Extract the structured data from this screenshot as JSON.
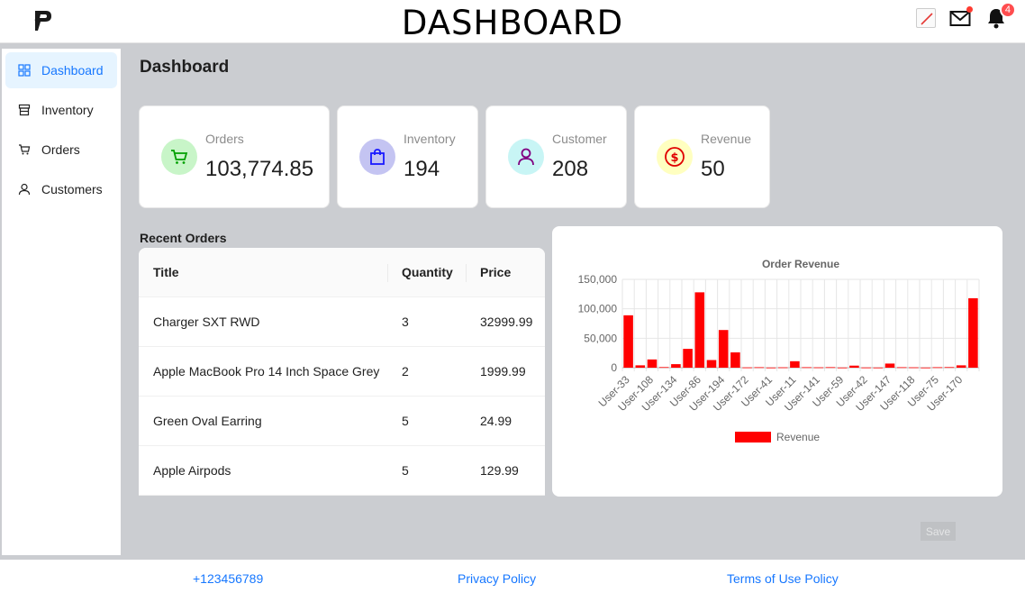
{
  "header": {
    "title": "DASHBOARD",
    "notification_count": "4"
  },
  "sidebar": {
    "items": [
      {
        "label": "Dashboard",
        "icon": "grid-icon",
        "active": true
      },
      {
        "label": "Inventory",
        "icon": "shop-icon"
      },
      {
        "label": "Orders",
        "icon": "cart-icon"
      },
      {
        "label": "Customers",
        "icon": "user-icon"
      }
    ]
  },
  "main": {
    "page_title": "Dashboard",
    "cards": [
      {
        "label": "Orders",
        "value": "103,774.85",
        "icon": "cart-icon",
        "color": "#00a000",
        "bg": "#c8f5c8"
      },
      {
        "label": "Inventory",
        "value": "194",
        "icon": "shopping-bag-icon",
        "color": "#1a1aff",
        "bg": "#c4c4f2"
      },
      {
        "label": "Customer",
        "value": "208",
        "icon": "user-icon",
        "color": "#800080",
        "bg": "#c8f5f5"
      },
      {
        "label": "Revenue",
        "value": "50",
        "icon": "dollar-circle-icon",
        "color": "#e00000",
        "bg": "#ffffc0"
      }
    ],
    "recent_orders": {
      "title": "Recent Orders",
      "columns": [
        "Title",
        "Quantity",
        "Price"
      ],
      "rows": [
        [
          "Charger SXT RWD",
          "3",
          "32999.99"
        ],
        [
          "Apple MacBook Pro 14 Inch Space Grey",
          "2",
          "1999.99"
        ],
        [
          "Green Oval Earring",
          "5",
          "24.99"
        ],
        [
          "Apple Airpods",
          "5",
          "129.99"
        ]
      ]
    },
    "save_label": "Save"
  },
  "chart_data": {
    "type": "bar",
    "title": "Order Revenue",
    "xlabel": "",
    "ylabel": "",
    "ylim": [
      0,
      150000
    ],
    "yticks": [
      "0",
      "50,000",
      "100,000",
      "150,000"
    ],
    "x_tick_labels": [
      "User-33",
      "User-108",
      "User-134",
      "User-86",
      "User-194",
      "User-172",
      "User-41",
      "User-11",
      "User-141",
      "User-59",
      "User-42",
      "User-147",
      "User-118",
      "User-75",
      "User-170"
    ],
    "color": "#ff0000",
    "series": [
      {
        "name": "Revenue",
        "values": [
          89000,
          4000,
          14000,
          1000,
          6000,
          32000,
          128000,
          13000,
          64000,
          26000,
          500,
          800,
          300,
          600,
          11000,
          800,
          600,
          900,
          300,
          3500,
          400,
          300,
          7000,
          800,
          600,
          300,
          800,
          1000,
          4000,
          118000
        ]
      }
    ],
    "legend": "bottom"
  },
  "footer": {
    "phone": "+123456789",
    "privacy": "Privacy Policy",
    "terms": "Terms of Use Policy"
  }
}
